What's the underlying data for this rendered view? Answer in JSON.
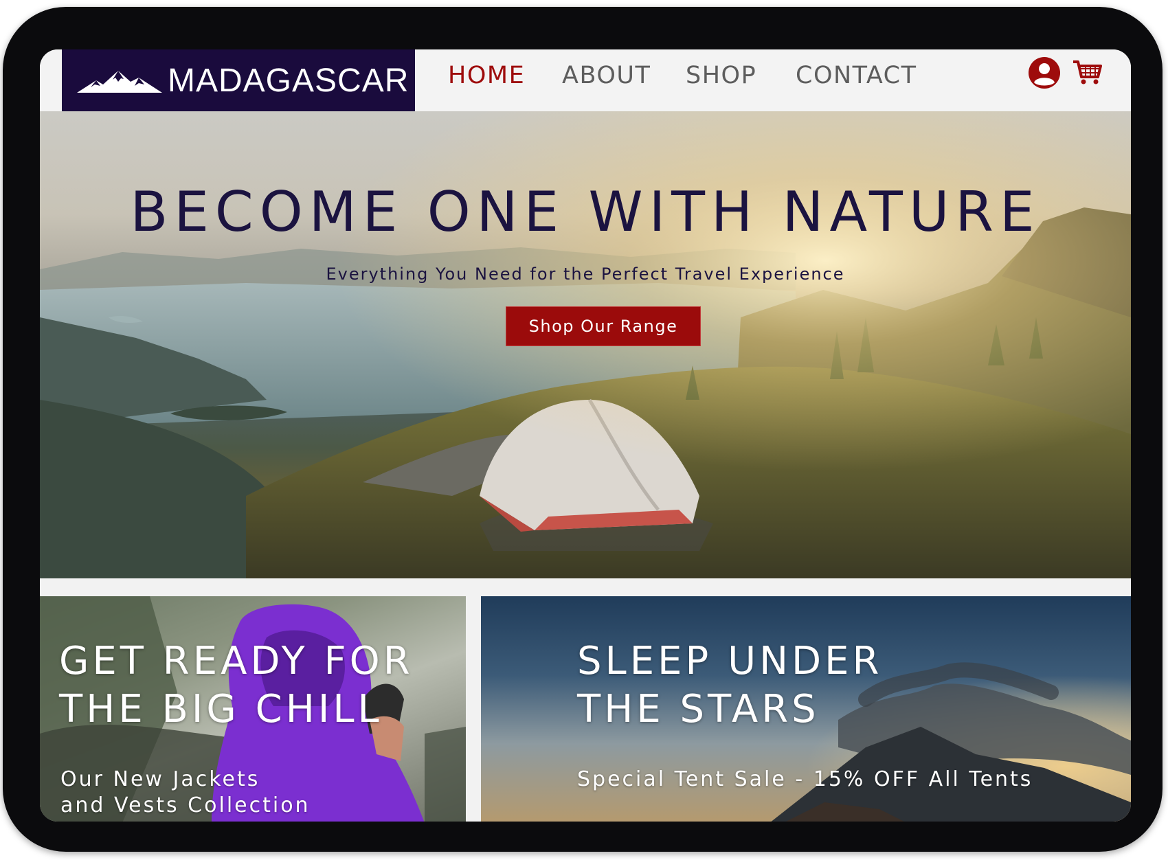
{
  "brand": {
    "name": "MADAGASCAR",
    "logo_icon": "mountain-logo-icon",
    "color": "#1a0b3d"
  },
  "nav": {
    "items": [
      {
        "label": "HOME",
        "active": true
      },
      {
        "label": "ABOUT",
        "active": false
      },
      {
        "label": "SHOP",
        "active": false
      },
      {
        "label": "CONTACT",
        "active": false
      }
    ],
    "active_color": "#9e0c0c",
    "icons": [
      "user-account-icon",
      "shopping-cart-icon"
    ]
  },
  "hero": {
    "title": "BECOME ONE WITH NATURE",
    "subtitle": "Everything You Need for the Perfect Travel Experience",
    "cta_label": "Shop Our Range",
    "cta_color": "#9b0b0b"
  },
  "promos": [
    {
      "title_line1": "GET READY FOR",
      "title_line2": "THE BIG CHILL",
      "text_line1": "Our New Jackets",
      "text_line2": "and Vests Collection"
    },
    {
      "title_line1": "SLEEP UNDER",
      "title_line2": "THE STARS",
      "text_line1": "Special Tent Sale - 15% OFF All Tents"
    }
  ]
}
